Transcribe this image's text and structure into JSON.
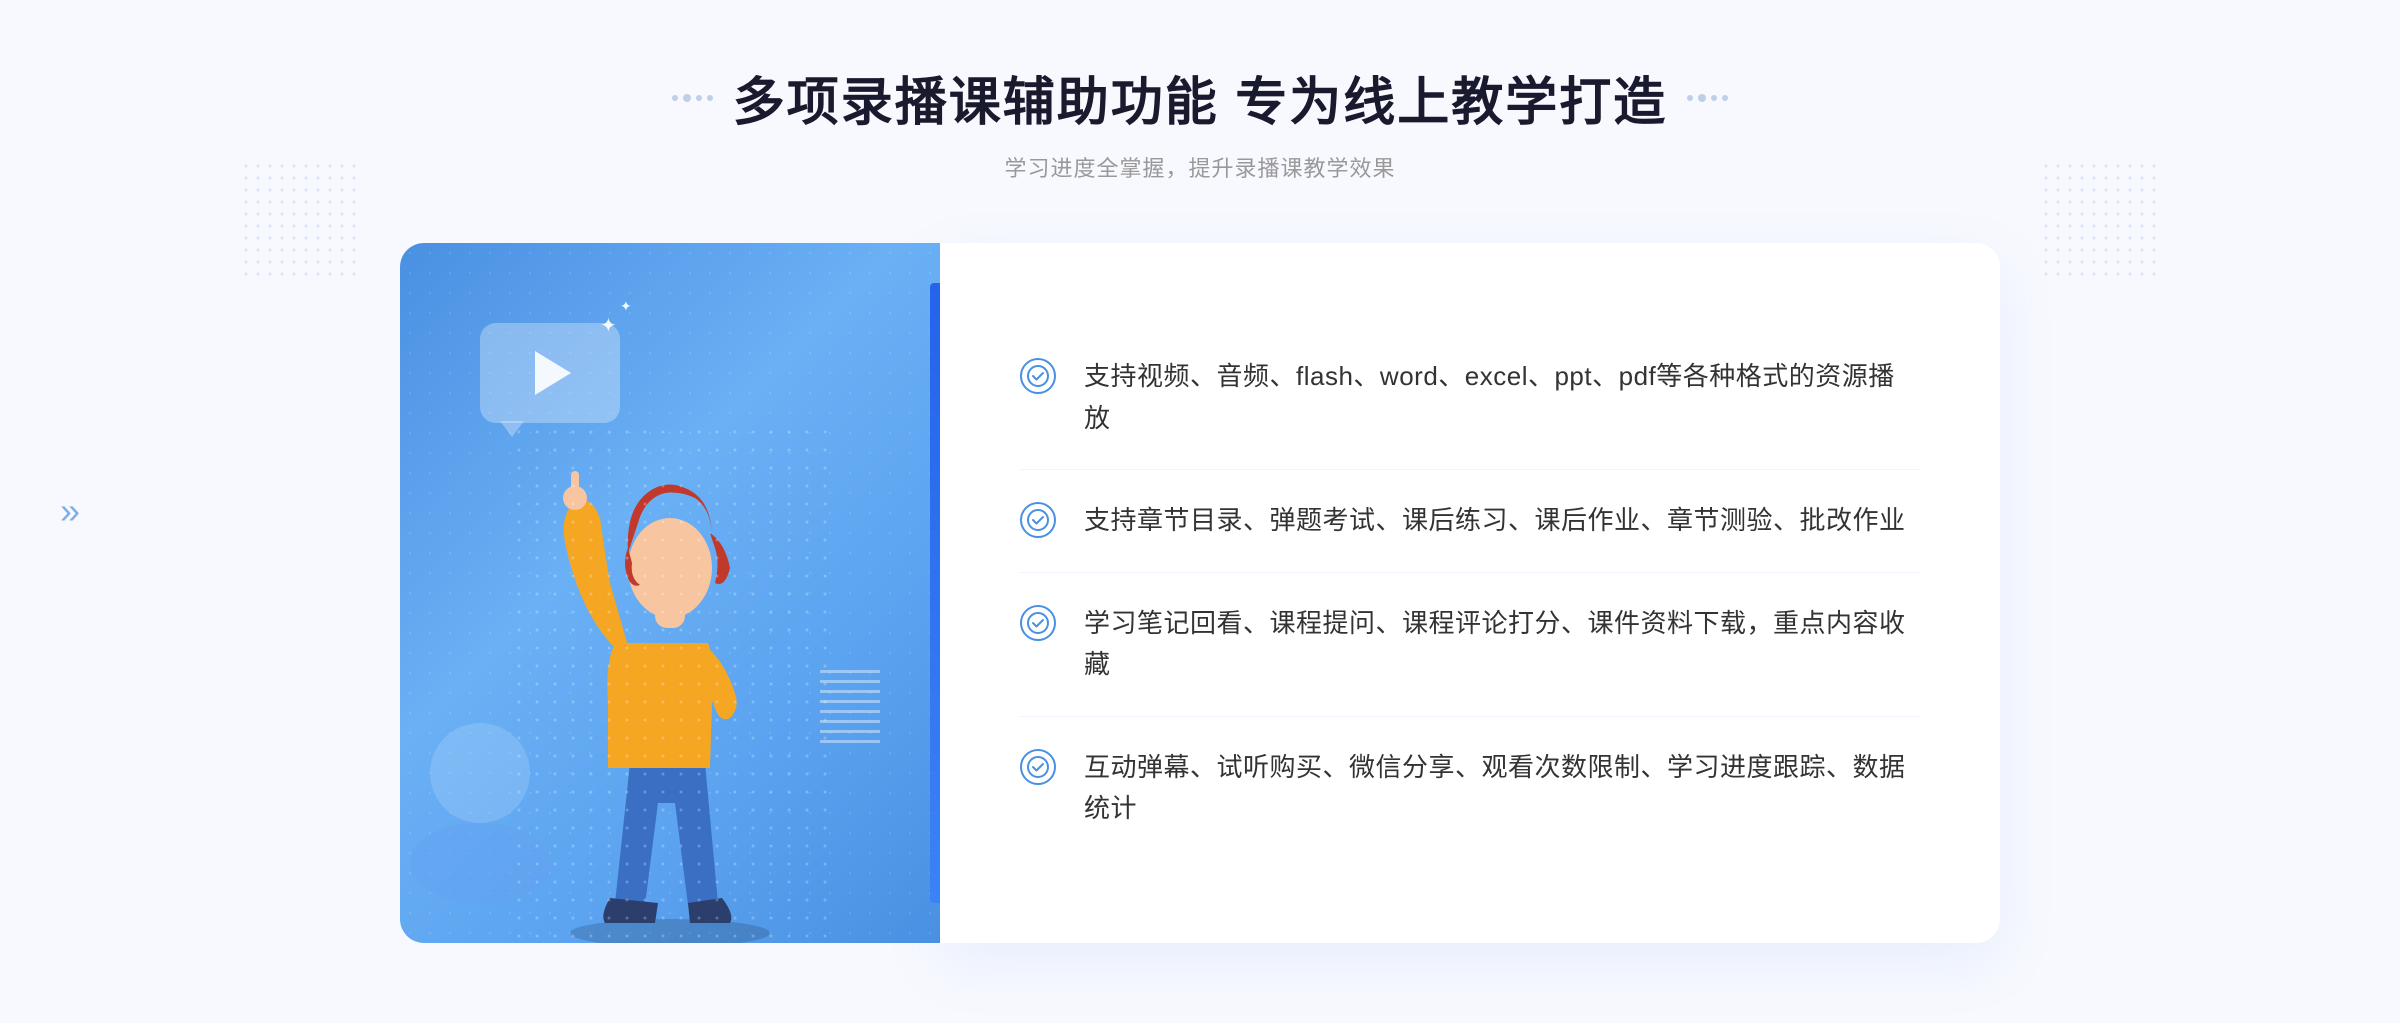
{
  "header": {
    "title": "多项录播课辅助功能 专为线上教学打造",
    "subtitle": "学习进度全掌握，提升录播课教学效果",
    "title_left_decorator": "≡",
    "title_right_decorator": "≡"
  },
  "features": [
    {
      "id": 1,
      "text": "支持视频、音频、flash、word、excel、ppt、pdf等各种格式的资源播放"
    },
    {
      "id": 2,
      "text": "支持章节目录、弹题考试、课后练习、课后作业、章节测验、批改作业"
    },
    {
      "id": 3,
      "text": "学习笔记回看、课程提问、课程评论打分、课件资料下载，重点内容收藏"
    },
    {
      "id": 4,
      "text": "互动弹幕、试听购买、微信分享、观看次数限制、学习进度跟踪、数据统计"
    }
  ],
  "colors": {
    "primary_blue": "#4a90e2",
    "dark_blue": "#2563eb",
    "title_color": "#1a1a2e",
    "text_color": "#333333",
    "subtitle_color": "#999999",
    "bg_color": "#f8f9ff"
  },
  "icons": {
    "check": "✓",
    "chevron_left": "»",
    "play": "▶",
    "sparkle": "✦"
  }
}
